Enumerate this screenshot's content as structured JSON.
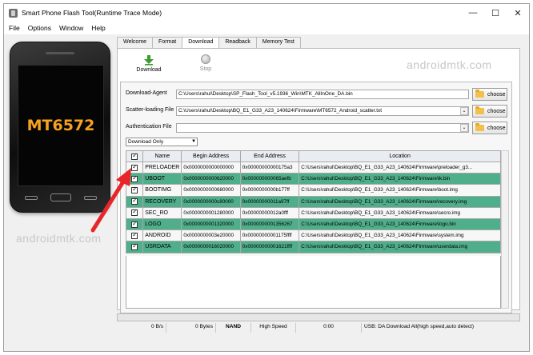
{
  "window": {
    "title": "Smart Phone Flash Tool(Runtime Trace Mode)",
    "controls": [
      "—",
      "☐",
      "✕"
    ]
  },
  "menu": [
    "File",
    "Options",
    "Window",
    "Help"
  ],
  "phone": {
    "chip": "MT6572"
  },
  "watermark": "androidmtk.com",
  "tabs": [
    "Welcome",
    "Format",
    "Download",
    "Readback",
    "Memory Test"
  ],
  "active_tab": "Download",
  "toolbar": {
    "download_label": "Download",
    "stop_label": "Stop"
  },
  "form": {
    "download_agent_label": "Download-Agent",
    "download_agent_value": "C:\\Users\\rahul\\Desktop\\SP_Flash_Tool_v5.1936_Win\\MTK_AllInOne_DA.bin",
    "scatter_label": "Scatter-loading File",
    "scatter_value": "C:\\Users\\rahul\\Desktop\\BQ_E1_G33_A23_140624\\Firmware\\MT6572_Android_scatter.txt",
    "auth_label": "Authentication File",
    "auth_value": "",
    "choose_label": "choose",
    "mode": "Download Only"
  },
  "table": {
    "headers": [
      "Name",
      "Begin Address",
      "End Address",
      "Location"
    ],
    "rows": [
      {
        "name": "PRELOADER",
        "begin": "0x0000000000000000",
        "end": "0x00000000000175a3",
        "loc": "C:\\Users\\rahul\\Desktop\\BQ_E1_G33_A23_140624\\Firmware\\preloader_g3...",
        "hl": false
      },
      {
        "name": "UBOOT",
        "begin": "0x0000000000620000",
        "end": "0x000000000065aefb",
        "loc": "C:\\Users\\rahul\\Desktop\\BQ_E1_G33_A23_140624\\Firmware\\lk.bin",
        "hl": true
      },
      {
        "name": "BOOTIMG",
        "begin": "0x0000000000680000",
        "end": "0x0000000000b177ff",
        "loc": "C:\\Users\\rahul\\Desktop\\BQ_E1_G33_A23_140624\\Firmware\\boot.img",
        "hl": false
      },
      {
        "name": "RECOVERY",
        "begin": "0x0000000000c80000",
        "end": "0x00000000011a97ff",
        "loc": "C:\\Users\\rahul\\Desktop\\BQ_E1_G33_A23_140624\\Firmware\\recovery.img",
        "hl": true
      },
      {
        "name": "SEC_RO",
        "begin": "0x0000000001280000",
        "end": "0x00000000012a0fff",
        "loc": "C:\\Users\\rahul\\Desktop\\BQ_E1_G33_A23_140624\\Firmware\\secro.img",
        "hl": false
      },
      {
        "name": "LOGO",
        "begin": "0x0000000001320000",
        "end": "0x0000000001356267",
        "loc": "C:\\Users\\rahul\\Desktop\\BQ_E1_G33_A23_140624\\Firmware\\logo.bin",
        "hl": true
      },
      {
        "name": "ANDROID",
        "begin": "0x0000000003e20000",
        "end": "0x00000000001175ffff",
        "loc": "C:\\Users\\rahul\\Desktop\\BQ_E1_G33_A23_140624\\Firmware\\system.img",
        "hl": false
      },
      {
        "name": "USRDATA",
        "begin": "0x0000000016020000",
        "end": "0x00000000001621ffff",
        "loc": "C:\\Users\\rahul\\Desktop\\BQ_E1_G33_A23_140624\\Firmware\\userdata.img",
        "hl": true
      }
    ]
  },
  "status": {
    "speed": "0 B/s",
    "bytes": "0 Bytes",
    "storage": "NAND",
    "usb_speed": "High Speed",
    "time": "0:00",
    "message": "USB: DA Download All(high speed,auto detect)"
  },
  "colors": {
    "highlight_row": "#4fae8b",
    "arrow": "#e8262a",
    "chip_text": "#f6a21f"
  }
}
